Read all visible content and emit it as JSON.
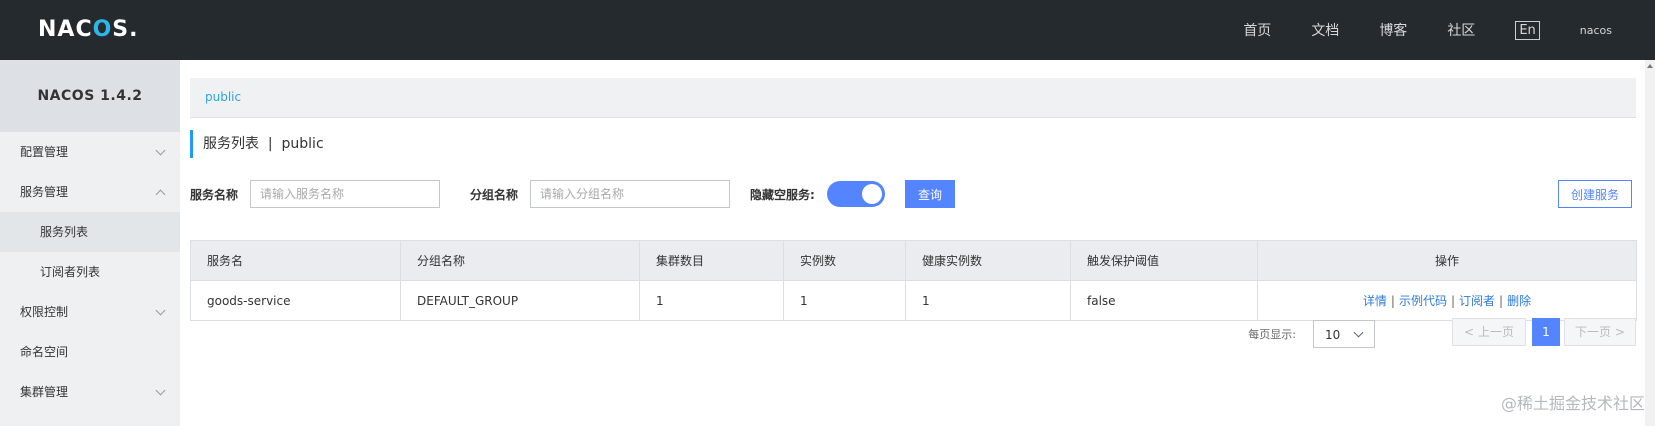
{
  "topbar": {
    "logo_a": "NAC",
    "logo_oo": "O",
    "logo_b": "S.",
    "nav": [
      "首页",
      "文档",
      "博客",
      "社区"
    ],
    "lang": "En",
    "user": "nacos"
  },
  "sidebar": {
    "title": "NACOS 1.4.2",
    "items": [
      {
        "label": "配置管理",
        "expandable": true,
        "expanded": false
      },
      {
        "label": "服务管理",
        "expandable": true,
        "expanded": true
      },
      {
        "label": "服务列表",
        "sub": true,
        "active": true
      },
      {
        "label": "订阅者列表",
        "sub": true
      },
      {
        "label": "权限控制",
        "expandable": true,
        "expanded": false
      },
      {
        "label": "命名空间"
      },
      {
        "label": "集群管理",
        "expandable": true,
        "expanded": false
      }
    ]
  },
  "breadcrumb": "public",
  "page_title": "服务列表  |  public",
  "filter": {
    "service_name_label": "服务名称",
    "service_name_placeholder": "请输入服务名称",
    "group_name_label": "分组名称",
    "group_name_placeholder": "请输入分组名称",
    "hide_empty_label": "隐藏空服务:",
    "hide_empty_on": true,
    "query_button": "查询",
    "create_button": "创建服务"
  },
  "table": {
    "headers": [
      "服务名",
      "分组名称",
      "集群数目",
      "实例数",
      "健康实例数",
      "触发保护阈值",
      "操作"
    ],
    "rows": [
      {
        "service": "goods-service",
        "group": "DEFAULT_GROUP",
        "clusters": "1",
        "instances": "1",
        "healthy": "1",
        "protect": "false"
      }
    ],
    "ops": [
      "详情",
      "示例代码",
      "订阅者",
      "删除"
    ]
  },
  "pagination": {
    "per_page_label": "每页显示:",
    "per_page_value": "10",
    "prev": "上一页",
    "current": "1",
    "next": "下一页"
  },
  "watermark": "@稀土掘金技术社区"
}
